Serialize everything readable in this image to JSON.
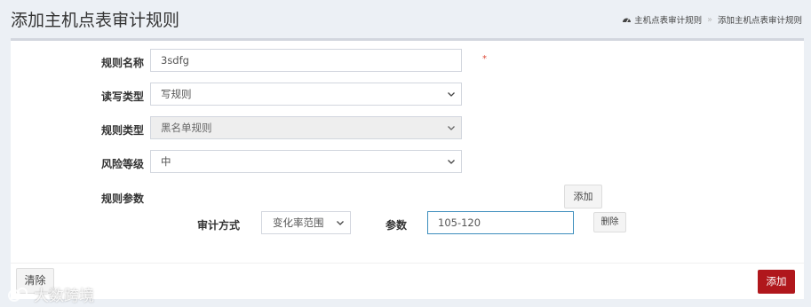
{
  "header": {
    "title": "添加主机点表审计规则",
    "breadcrumb": {
      "items": [
        "主机点表审计规则",
        "添加主机点表审计规则"
      ],
      "separator": "»"
    }
  },
  "form": {
    "rule_name": {
      "label": "规则名称",
      "value": "3sdfg",
      "required_mark": "*"
    },
    "rw_type": {
      "label": "读写类型",
      "selected": "写规则"
    },
    "rule_type": {
      "label": "规则类型",
      "selected": "黑名单规则"
    },
    "risk_level": {
      "label": "风险等级",
      "selected": "中"
    },
    "rule_params": {
      "label": "规则参数",
      "add_label": "添加",
      "audit_method_label": "审计方式",
      "audit_method_selected": "变化率范围",
      "param_label": "参数",
      "param_value": "105-120",
      "delete_label": "删除"
    }
  },
  "footer": {
    "clear_label": "清除",
    "submit_label": "添加"
  },
  "watermark": {
    "text": "大数跨境"
  },
  "colors": {
    "primary_action": "#b0171c",
    "required": "#dd4b39",
    "focus_border": "#3c8dbc"
  },
  "icons": [
    "dashboard-icon",
    "chevron-down-icon",
    "watermark-logo-icon"
  ]
}
